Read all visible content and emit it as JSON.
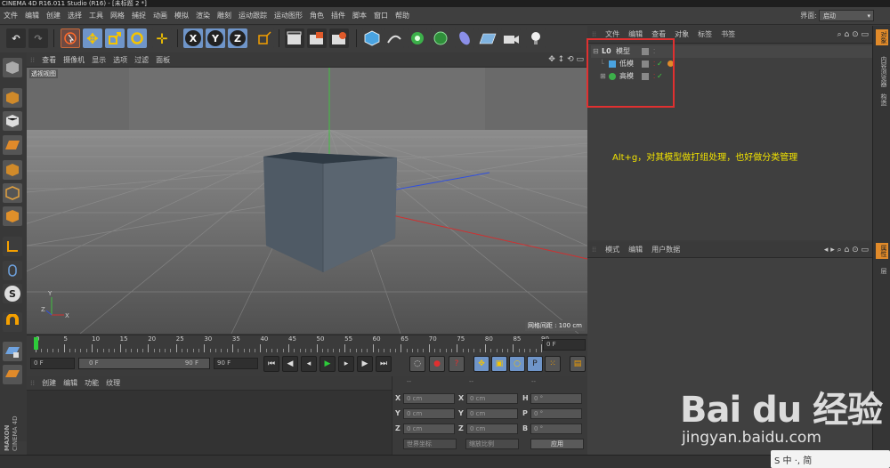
{
  "window": {
    "title": "CINEMA 4D R16.011 Studio (R16) - [未标题 2 *]"
  },
  "menubar": {
    "items": [
      "文件",
      "编辑",
      "创建",
      "选择",
      "工具",
      "网格",
      "捕捉",
      "动画",
      "模拟",
      "渲染",
      "雕刻",
      "运动跟踪",
      "运动图形",
      "角色",
      "插件",
      "脚本",
      "窗口",
      "帮助"
    ],
    "layout_label": "界面:",
    "layout_value": "启动"
  },
  "toolbar": {
    "icons": [
      "undo-icon",
      "redo-icon",
      "live-select-icon",
      "move-icon",
      "scale-icon",
      "rotate-icon",
      "add-icon",
      "x-axis-icon",
      "y-axis-icon",
      "z-axis-icon",
      "coordinate-system-icon",
      "render-view-icon",
      "render-picture-queue-icon",
      "render-settings-icon",
      "cube-icon",
      "pen-icon",
      "subdivide-icon",
      "array-icon",
      "deformer-icon",
      "floor-icon",
      "camera-icon",
      "light-icon"
    ],
    "axis_labels": [
      "X",
      "Y",
      "Z"
    ]
  },
  "viewport": {
    "menu": [
      "查看",
      "摄像机",
      "显示",
      "选项",
      "过滤",
      "面板"
    ],
    "label": "透视视图",
    "grid_spacing": "网格间距 : 100 cm"
  },
  "timeline": {
    "ticks": [
      "0",
      "5",
      "10",
      "15",
      "20",
      "25",
      "30",
      "35",
      "40",
      "45",
      "50",
      "55",
      "60",
      "65",
      "70",
      "75",
      "80",
      "85",
      "90"
    ],
    "current_frame": "0 F",
    "start_frame": "0 F",
    "range_start": "0 F",
    "range_end": "90 F",
    "end_frame": "90 F"
  },
  "material": {
    "menu": [
      "创建",
      "编辑",
      "功能",
      "纹理"
    ]
  },
  "coordinates": {
    "headers": [
      "--",
      "--",
      "--"
    ],
    "rows": [
      {
        "axis": "X",
        "pos": "0 cm",
        "size_axis": "X",
        "size": "0 cm",
        "rot_axis": "H",
        "rot": "0 °"
      },
      {
        "axis": "Y",
        "pos": "0 cm",
        "size_axis": "Y",
        "size": "0 cm",
        "rot_axis": "P",
        "rot": "0 °"
      },
      {
        "axis": "Z",
        "pos": "0 cm",
        "size_axis": "Z",
        "size": "0 cm",
        "rot_axis": "B",
        "rot": "0 °"
      }
    ],
    "mode": "世界坐标",
    "scale_mode": "缩放比例",
    "apply": "应用"
  },
  "object_manager": {
    "menu": [
      "文件",
      "编辑",
      "查看",
      "对象",
      "标签",
      "书签"
    ],
    "objects": [
      {
        "name": "模型",
        "icon": "null-icon",
        "level": 0
      },
      {
        "name": "低模",
        "icon": "cube-icon",
        "level": 1
      },
      {
        "name": "高模",
        "icon": "subdivision-icon",
        "level": 1
      }
    ],
    "annotation": "Alt+g，对其模型做打组处理，也好做分类管理"
  },
  "attribute_manager": {
    "menu": [
      "模式",
      "编辑",
      "用户数据"
    ]
  },
  "right_tabs": [
    "对象",
    "内容浏览器",
    "构造",
    "属性",
    "层"
  ],
  "brand": {
    "maxon": "MAXON",
    "cinema": "CINEMA 4D"
  },
  "watermark": {
    "logo": "Bai du 经验",
    "url": "jingyan.baidu.com"
  },
  "ime": {
    "label": "S 中 ·, 简"
  },
  "colors": {
    "selection_red": "#e03030",
    "annotation_yellow": "#f2e300",
    "accent_blue": "#6f95c9"
  }
}
